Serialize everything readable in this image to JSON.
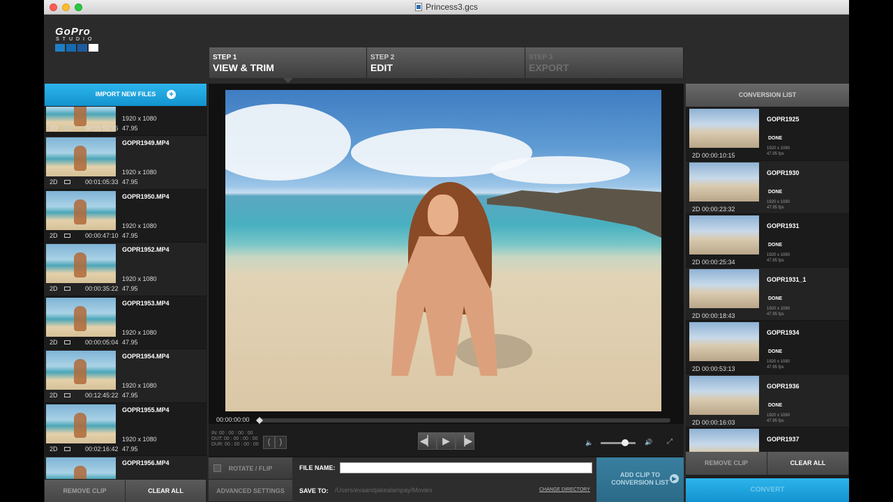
{
  "window": {
    "title": "Princess3.gcs"
  },
  "logo": {
    "main": "GoPro",
    "sub": "STUDIO",
    "squares": [
      "#1f7fc6",
      "#176ab0",
      "#1f5b9c",
      "#ffffff"
    ]
  },
  "steps": [
    {
      "num": "STEP 1",
      "name": "VIEW & TRIM",
      "state": "active"
    },
    {
      "num": "STEP 2",
      "name": "EDIT",
      "state": "normal"
    },
    {
      "num": "STEP 3",
      "name": "EXPORT",
      "state": "disabled"
    }
  ],
  "left": {
    "import_label": "IMPORT NEW FILES",
    "files": [
      {
        "name": "",
        "res": "1920 x 1080",
        "mode": "2D",
        "duration": "00:01:53:36",
        "fps": "47.95"
      },
      {
        "name": "GOPR1949.MP4",
        "res": "1920 x 1080",
        "mode": "2D",
        "duration": "00:01:05:33",
        "fps": "47.95"
      },
      {
        "name": "GOPR1950.MP4",
        "res": "1920 x 1080",
        "mode": "2D",
        "duration": "00:00:47:10",
        "fps": "47.95"
      },
      {
        "name": "GOPR1952.MP4",
        "res": "1920 x 1080",
        "mode": "2D",
        "duration": "00:00:35:22",
        "fps": "47.95"
      },
      {
        "name": "GOPR1953.MP4",
        "res": "1920 x 1080",
        "mode": "2D",
        "duration": "00:00:05:04",
        "fps": "47.95"
      },
      {
        "name": "GOPR1954.MP4",
        "res": "1920 x 1080",
        "mode": "2D",
        "duration": "00:12:45:22",
        "fps": "47.95"
      },
      {
        "name": "GOPR1955.MP4",
        "res": "1920 x 1080",
        "mode": "2D",
        "duration": "00:02:16:42",
        "fps": "47.95"
      },
      {
        "name": "GOPR1956.MP4",
        "res": "",
        "mode": "",
        "duration": "",
        "fps": ""
      }
    ],
    "remove_label": "REMOVE CLIP",
    "clear_label": "CLEAR ALL"
  },
  "player": {
    "timecode": "00:00:00:00",
    "in": "IN:  00 : 00 : 00 : 00",
    "out": "OUT: 00 : 00 : 00 : 00",
    "dur": "DUR: 00 : 00 : 00 : 00",
    "volume": 0.7
  },
  "bottom": {
    "rotate_label": "ROTATE / FLIP",
    "advanced_label": "ADVANCED SETTINGS",
    "file_name_label": "FILE NAME:",
    "file_name_value": "",
    "save_to_label": "SAVE TO:",
    "save_path": "/Users/evaandjakealampay/Movies",
    "change_dir": "CHANGE DIRECTORY",
    "add_clip_line1": "ADD CLIP TO",
    "add_clip_line2": "CONVERSION LIST"
  },
  "right": {
    "header": "CONVERSION LIST",
    "items": [
      {
        "name": "GOPR1925",
        "status": "DONE",
        "res": "1920 x 1080",
        "fps": "47.95 fps",
        "mode_dur": "2D 00:00:10:15"
      },
      {
        "name": "GOPR1930",
        "status": "DONE",
        "res": "1920 x 1080",
        "fps": "47.95 fps",
        "mode_dur": "2D 00:00:23:32"
      },
      {
        "name": "GOPR1931",
        "status": "DONE",
        "res": "1920 x 1080",
        "fps": "47.95 fps",
        "mode_dur": "2D 00:00:25:34"
      },
      {
        "name": "GOPR1931_1",
        "status": "DONE",
        "res": "1920 x 1080",
        "fps": "47.95 fps",
        "mode_dur": "2D 00:00:18:43"
      },
      {
        "name": "GOPR1934",
        "status": "DONE",
        "res": "1920 x 1080",
        "fps": "47.95 fps",
        "mode_dur": "2D 00:00:53:13"
      },
      {
        "name": "GOPR1936",
        "status": "DONE",
        "res": "1920 x 1080",
        "fps": "47.95 fps",
        "mode_dur": "2D 00:00:16:03"
      },
      {
        "name": "GOPR1937",
        "status": "",
        "res": "",
        "fps": "",
        "mode_dur": ""
      }
    ],
    "remove_label": "REMOVE CLIP",
    "clear_label": "CLEAR ALL",
    "convert_label": "CONVERT"
  }
}
